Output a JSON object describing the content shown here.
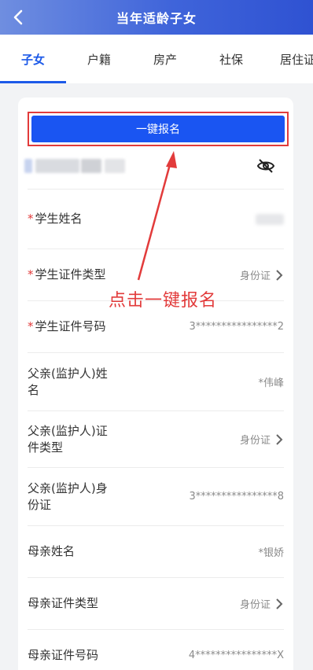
{
  "header": {
    "title": "当年适龄子女"
  },
  "tabs": [
    {
      "label": "子女"
    },
    {
      "label": "户籍"
    },
    {
      "label": "房产"
    },
    {
      "label": "社保"
    },
    {
      "label": "居住证"
    }
  ],
  "card": {
    "onekey_label": "一键报名",
    "rows": [
      {
        "label": "学生姓名",
        "required": true,
        "value": ""
      },
      {
        "label": "学生证件类型",
        "required": true,
        "value": "身份证"
      },
      {
        "label": "学生证件号码",
        "required": true,
        "value": "3****************2"
      },
      {
        "label": "父亲(监护人)姓名",
        "required": false,
        "value": "*伟峰"
      },
      {
        "label": "父亲(监护人)证件类型",
        "required": false,
        "value": "身份证"
      },
      {
        "label": "父亲(监护人)身份证",
        "required": false,
        "value": "3****************8"
      },
      {
        "label": "母亲姓名",
        "required": false,
        "value": "*银娇"
      },
      {
        "label": "母亲证件类型",
        "required": false,
        "value": "身份证"
      },
      {
        "label": "母亲证件号码",
        "required": false,
        "value": "4****************X"
      }
    ]
  },
  "annotation": {
    "text": "点击一键报名",
    "color": "#e23b3b"
  },
  "colors": {
    "brand_blue": "#1a55f2",
    "tab_active": "#1d5ae8",
    "required_star": "#e23b3b"
  }
}
